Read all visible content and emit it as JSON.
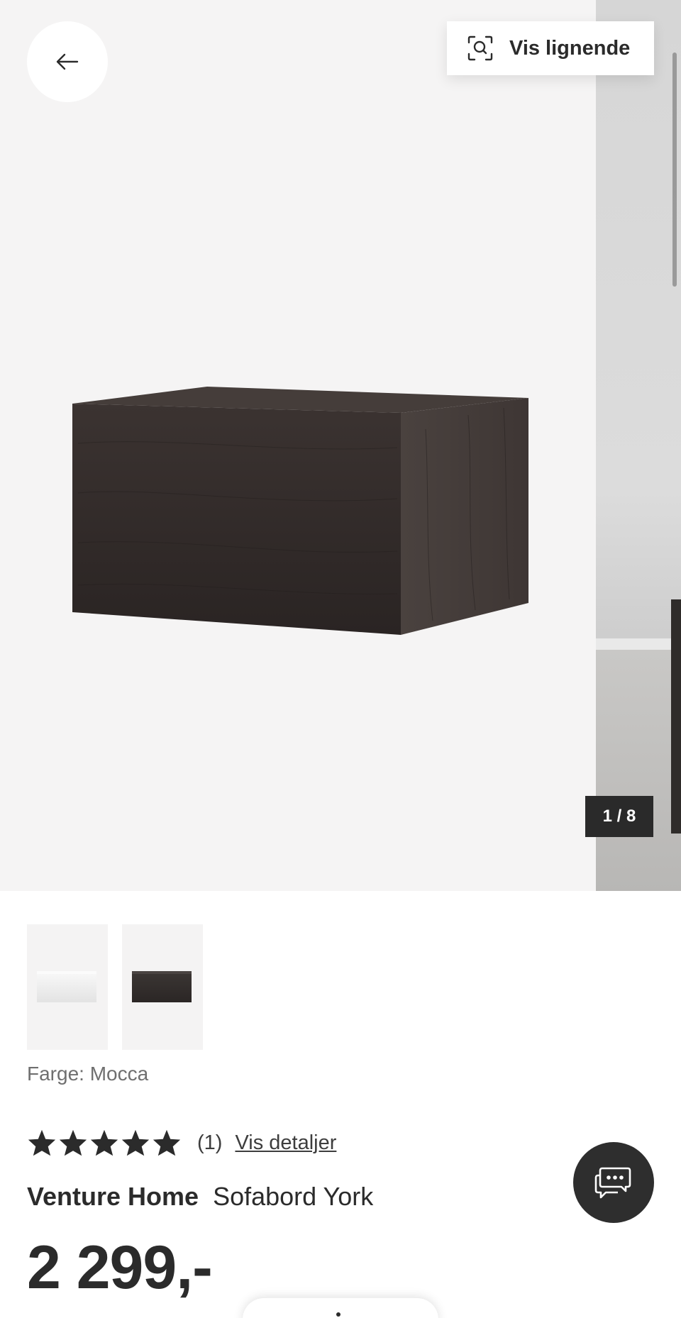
{
  "gallery": {
    "similar_label": "Vis lignende",
    "counter": "1 / 8",
    "current_image": 1,
    "total_images": 8
  },
  "thumbnails": [
    {
      "name": "white"
    },
    {
      "name": "dark"
    }
  ],
  "color": {
    "label": "Farge: Mocca"
  },
  "rating": {
    "stars": 5,
    "count_label": "(1)",
    "details_label": "Vis detaljer"
  },
  "product": {
    "brand": "Venture Home",
    "name": "Sofabord York",
    "price": "2 299,-"
  },
  "colors": {
    "text": "#2b2b2b",
    "gallery_bg": "#f5f4f4",
    "counter_bg": "#2a2a2a",
    "chat_bg": "#2e2e2e"
  },
  "icons": {
    "back": "arrow-left-icon",
    "similar": "visual-search-icon",
    "chat": "chat-bubbles-icon",
    "star": "star-icon"
  }
}
